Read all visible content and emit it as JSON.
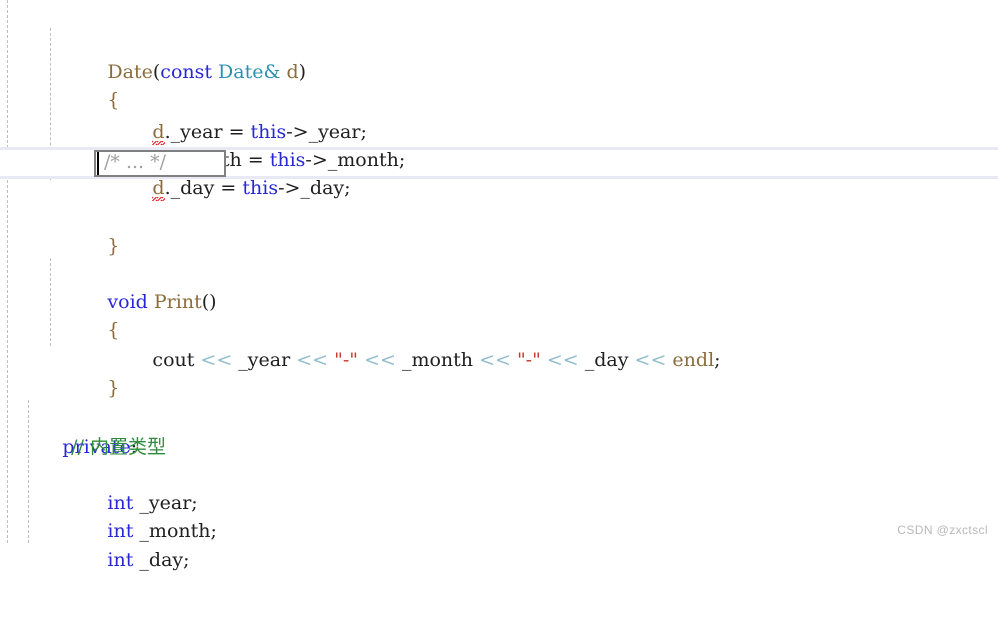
{
  "editor": {
    "language": "cpp",
    "colors": {
      "background": "#ffffff",
      "keyword": "#2727d8",
      "user_type": "#2b91af",
      "identifier": "#8a6d3b",
      "string": "#c43b2e",
      "stream_operator": "#8fbccd",
      "comment": "#2e8b3d",
      "placeholder": "#a0a0a0",
      "current_line_border": "#e9e9f4",
      "snippet_box_border": "#808080",
      "error_squiggle": "#e02020",
      "indent_guide": "#bfbfbf",
      "watermark": "#b9b9b9"
    }
  },
  "code": {
    "line1": {
      "t1": "Date",
      "t2": "(",
      "t3": "const",
      "t4": " ",
      "t5": "Date&",
      "t6": " ",
      "t7": "d",
      "t8": ")"
    },
    "line2": {
      "brace": "{"
    },
    "line3": {
      "obj": "d",
      "dot_member": "._year ",
      "eq": "= ",
      "this": "this",
      "arrow_member": "->_year;"
    },
    "line4": {
      "obj": "d",
      "dot_member": "._month ",
      "eq": "= ",
      "this": "this",
      "arrow_member": "->_month;"
    },
    "line5": {
      "obj": "d",
      "dot_member": "._day ",
      "eq": "= ",
      "this": "this",
      "arrow_member": "->_day;"
    },
    "line6_snippet": "/* ... */",
    "line7": {
      "brace": "}"
    },
    "line8": {
      "blank": " "
    },
    "line9": {
      "kw": "void",
      "sp": " ",
      "name": "Print",
      "parens": "()"
    },
    "line10": {
      "brace": "{"
    },
    "line11": {
      "cout": "cout ",
      "op1": "<<",
      "y": " _year ",
      "op2": "<<",
      "s1": " \"-\" ",
      "op3": "<<",
      "m": " _month ",
      "op4": "<<",
      "s2": " \"-\" ",
      "op5": "<<",
      "d": " _day ",
      "op6": "<<",
      "endl": " endl",
      "semi": ";"
    },
    "line12": {
      "brace": "}"
    },
    "line13": {
      "blank": " "
    },
    "line14": {
      "kw": "private",
      "colon": ":"
    },
    "line15": {
      "comment": "// 内置类型"
    },
    "line16": {
      "kw": "int",
      "sp": " ",
      "name": "_year;"
    },
    "line17": {
      "kw": "int",
      "sp": " ",
      "name": "_month;"
    },
    "line18": {
      "kw": "int",
      "sp": " ",
      "name": "_day;"
    }
  },
  "watermark": {
    "text": "CSDN @zxctscl"
  }
}
